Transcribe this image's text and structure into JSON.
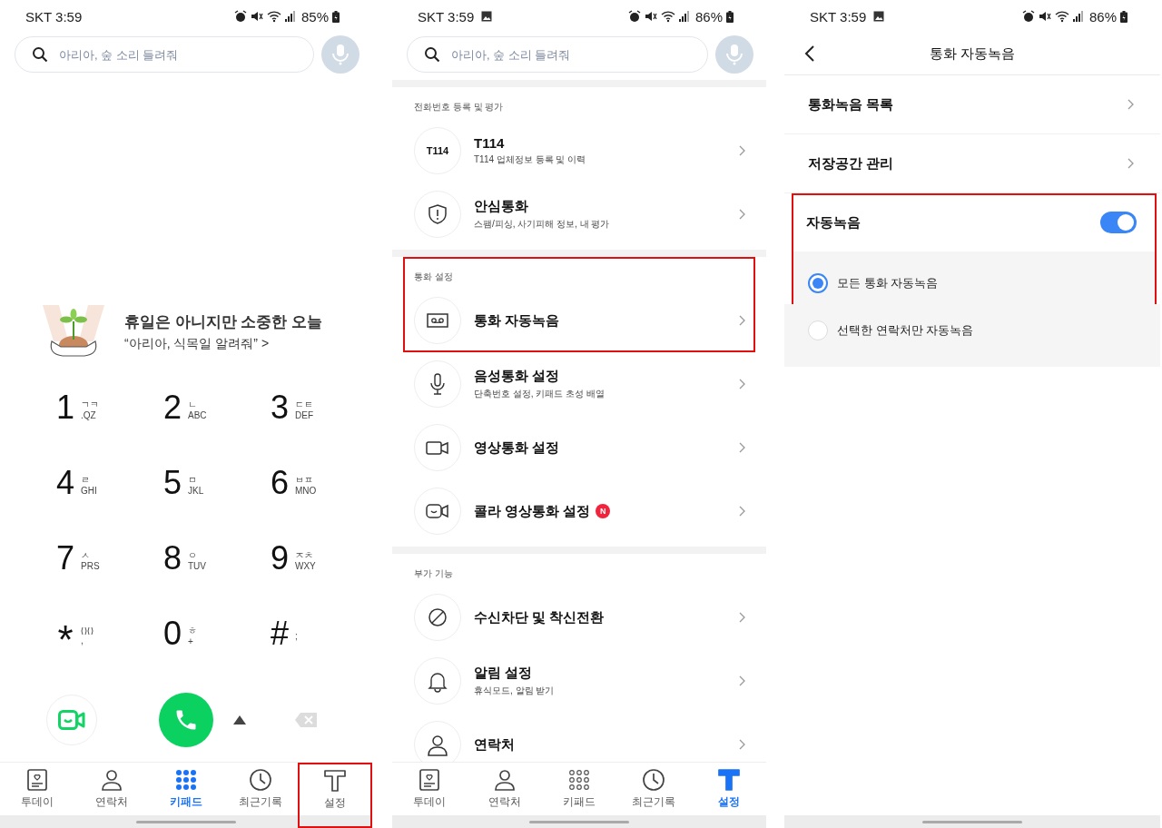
{
  "dialer": {
    "status": {
      "time": "SKT 3:59",
      "battery": "85%",
      "image_notification": false
    },
    "search": {
      "placeholder": "아리아, 숲 소리 들려줘"
    },
    "banner": {
      "title": "휴일은 아니지만 소중한 오늘",
      "subtitle": "“아리아, 식목일 알려줘” >"
    },
    "keys": [
      {
        "digit": "1",
        "hangul": "ㄱㅋ",
        "latin": ".QZ"
      },
      {
        "digit": "2",
        "hangul": "ㄴ",
        "latin": "ABC"
      },
      {
        "digit": "3",
        "hangul": "ㄷㅌ",
        "latin": "DEF"
      },
      {
        "digit": "4",
        "hangul": "ㄹ",
        "latin": "GHI"
      },
      {
        "digit": "5",
        "hangul": "ㅁ",
        "latin": "JKL"
      },
      {
        "digit": "6",
        "hangul": "ㅂㅍ",
        "latin": "MNO"
      },
      {
        "digit": "7",
        "hangul": "ㅅ",
        "latin": "PRS"
      },
      {
        "digit": "8",
        "hangul": "ㅇ",
        "latin": "TUV"
      },
      {
        "digit": "9",
        "hangul": "ㅈㅊ",
        "latin": "WXY"
      },
      {
        "digit": "*",
        "kind": "star",
        "latin": ","
      },
      {
        "digit": "0",
        "hangul": "ㅎ",
        "latin": "+"
      },
      {
        "digit": "#",
        "latin": ";"
      }
    ],
    "nav": [
      {
        "label": "투데이",
        "selected": false,
        "highlighted": false
      },
      {
        "label": "연락처",
        "selected": false,
        "highlighted": false
      },
      {
        "label": "키패드",
        "selected": true,
        "highlighted": false
      },
      {
        "label": "최근기록",
        "selected": false,
        "highlighted": false
      },
      {
        "label": "설정",
        "selected": false,
        "highlighted": true
      }
    ]
  },
  "settings": {
    "status": {
      "time": "SKT 3:59",
      "battery": "86%",
      "image_notification": true
    },
    "search": {
      "placeholder": "아리아, 숲 소리 들려줘"
    },
    "sections": [
      {
        "header": "전화번호 등록 및 평가",
        "highlighted": false,
        "items": [
          {
            "icon_text": "T114",
            "title": "T114",
            "subtitle": "T114 업체정보 등록 및 이력"
          },
          {
            "title": "안심통화",
            "subtitle": "스팸/피싱, 사기피해 정보, 내 평가"
          }
        ]
      },
      {
        "header": "통화 설정",
        "highlighted": true,
        "items": [
          {
            "title": "통화 자동녹음"
          },
          {
            "title": "음성통화 설정",
            "subtitle": "단축번호 설정, 키패드 초성 배열"
          },
          {
            "title": "영상통화 설정"
          },
          {
            "title": "콜라 영상통화 설정",
            "badge": "N"
          }
        ]
      },
      {
        "header": "부가 기능",
        "highlighted": false,
        "items": [
          {
            "title": "수신차단 및 착신전환"
          },
          {
            "title": "알림 설정",
            "subtitle": "휴식모드, 알림 받기"
          },
          {
            "title": "연락처"
          }
        ]
      }
    ],
    "nav": [
      {
        "label": "투데이",
        "selected": false,
        "highlighted": false
      },
      {
        "label": "연락처",
        "selected": false,
        "highlighted": false
      },
      {
        "label": "키패드",
        "selected": false,
        "highlighted": false
      },
      {
        "label": "최근기록",
        "selected": false,
        "highlighted": false
      },
      {
        "label": "설정",
        "selected": true,
        "highlighted": false
      }
    ]
  },
  "auto_record": {
    "status": {
      "time": "SKT 3:59",
      "battery": "86%",
      "image_notification": true
    },
    "title": "통화 자동녹음",
    "links": [
      "통화녹음 목록",
      "저장공간 관리"
    ],
    "toggle": {
      "label": "자동녹음",
      "on": true
    },
    "highlighted": true,
    "options": [
      {
        "label": "모든 통화 자동녹음",
        "selected": true
      },
      {
        "label": "선택한 연락처만 자동녹음",
        "selected": false
      }
    ]
  }
}
